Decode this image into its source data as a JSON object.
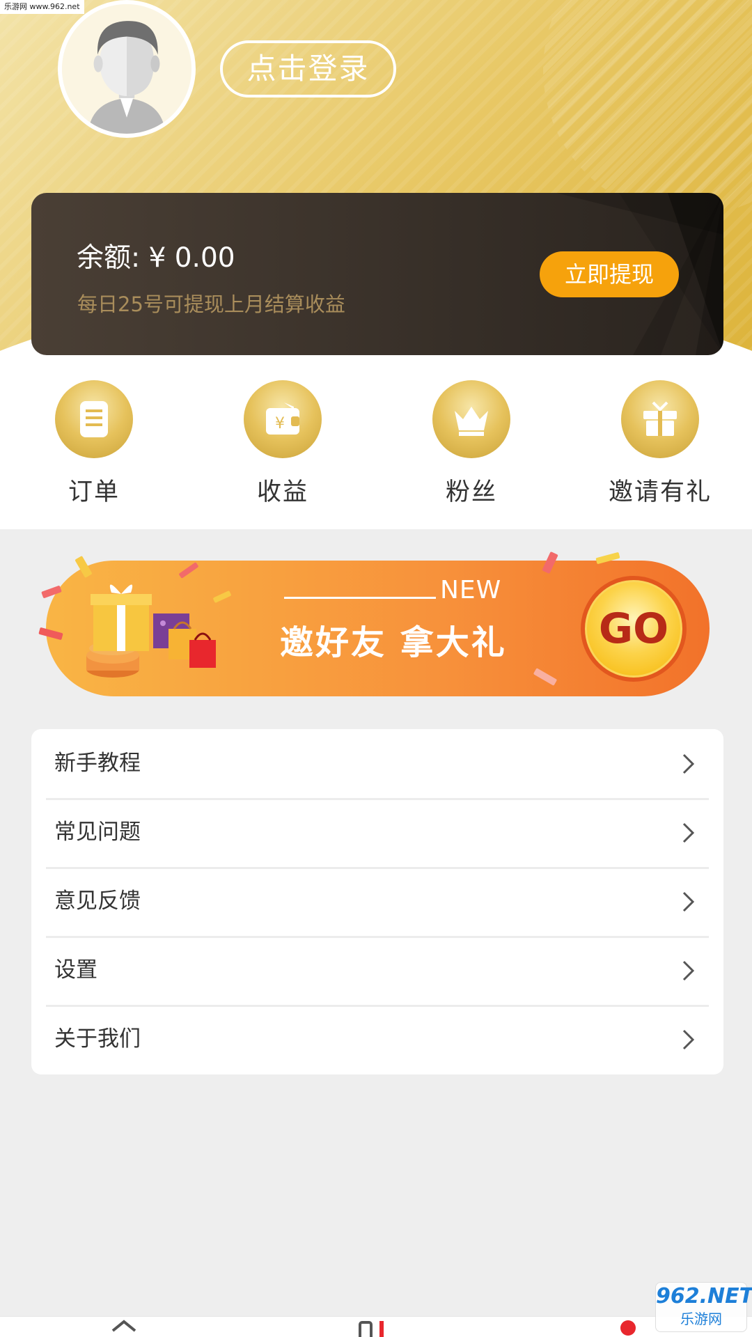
{
  "watermark_top": "乐游网 www.962.net",
  "profile": {
    "avatar_icon": "user-avatar-icon",
    "login_label": "点击登录"
  },
  "balance": {
    "label": "余额: ¥ 0.00",
    "note": "每日25号可提现上月结算收益",
    "withdraw_label": "立即提现"
  },
  "quick_menu": [
    {
      "label": "订单",
      "icon": "order-icon"
    },
    {
      "label": "收益",
      "icon": "wallet-icon"
    },
    {
      "label": "粉丝",
      "icon": "crown-icon"
    },
    {
      "label": "邀请有礼",
      "icon": "gift-icon"
    }
  ],
  "banner": {
    "new_text": "NEW",
    "title": "邀好友  拿大礼",
    "go_label": "GO"
  },
  "menu_list": [
    {
      "label": "新手教程"
    },
    {
      "label": "常见问题"
    },
    {
      "label": "意见反馈"
    },
    {
      "label": "设置"
    },
    {
      "label": "关于我们"
    }
  ],
  "watermark_bottom": {
    "top": "962.NET",
    "bottom": "乐游网"
  },
  "colors": {
    "gold": "#e6c25c",
    "card_dark": "#2a241f",
    "withdraw_orange": "#f6a20c",
    "banner_orange": "#f7913b",
    "go_red": "#b72a17"
  }
}
